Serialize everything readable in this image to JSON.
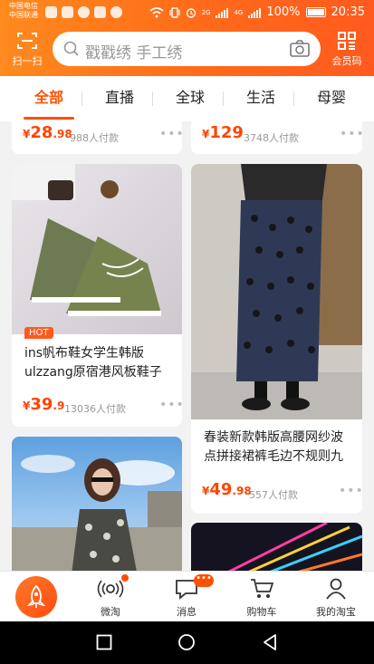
{
  "status_bar": {
    "carrier_1": "中国电信",
    "carrier_2": "中国联通",
    "network_1": "2G",
    "network_2": "4G",
    "battery": "100%",
    "time": "20:35"
  },
  "header": {
    "scan_label": "扫一扫",
    "search_placeholder": "戳戳绣 手工绣",
    "member_label": "会员码"
  },
  "tabs": [
    {
      "label": "全部",
      "active": true
    },
    {
      "label": "直播"
    },
    {
      "label": "全球"
    },
    {
      "label": "生活"
    },
    {
      "label": "母婴"
    }
  ],
  "products": [
    {
      "price_yen": "¥",
      "price_int": "28",
      "price_dec": ".98",
      "paid": "988人付款"
    },
    {
      "price_yen": "¥",
      "price_int": "129",
      "price_dec": "",
      "paid": "3748人付款"
    },
    {
      "badge": "HOT",
      "title": "ins帆布鞋女学生韩版ulzzang原宿港风板鞋子",
      "price_yen": "¥",
      "price_int": "39",
      "price_dec": ".9",
      "paid": "13036人付款"
    },
    {
      "title": "春装新款韩版高腰网纱波点拼接裙裤毛边不规则九",
      "price_yen": "¥",
      "price_int": "49",
      "price_dec": ".98",
      "paid": "557人付款"
    }
  ],
  "more_glyph": "•••",
  "bottom_nav": {
    "weitao": "微淘",
    "messages": "消息",
    "messages_badge": "•••",
    "cart": "购物车",
    "my_taobao": "我的淘宝"
  },
  "colors": {
    "accent": "#ff5000",
    "price": "#ff4400",
    "header_gradient_start": "#ff8a1e",
    "header_gradient_end": "#ff5a1e"
  }
}
